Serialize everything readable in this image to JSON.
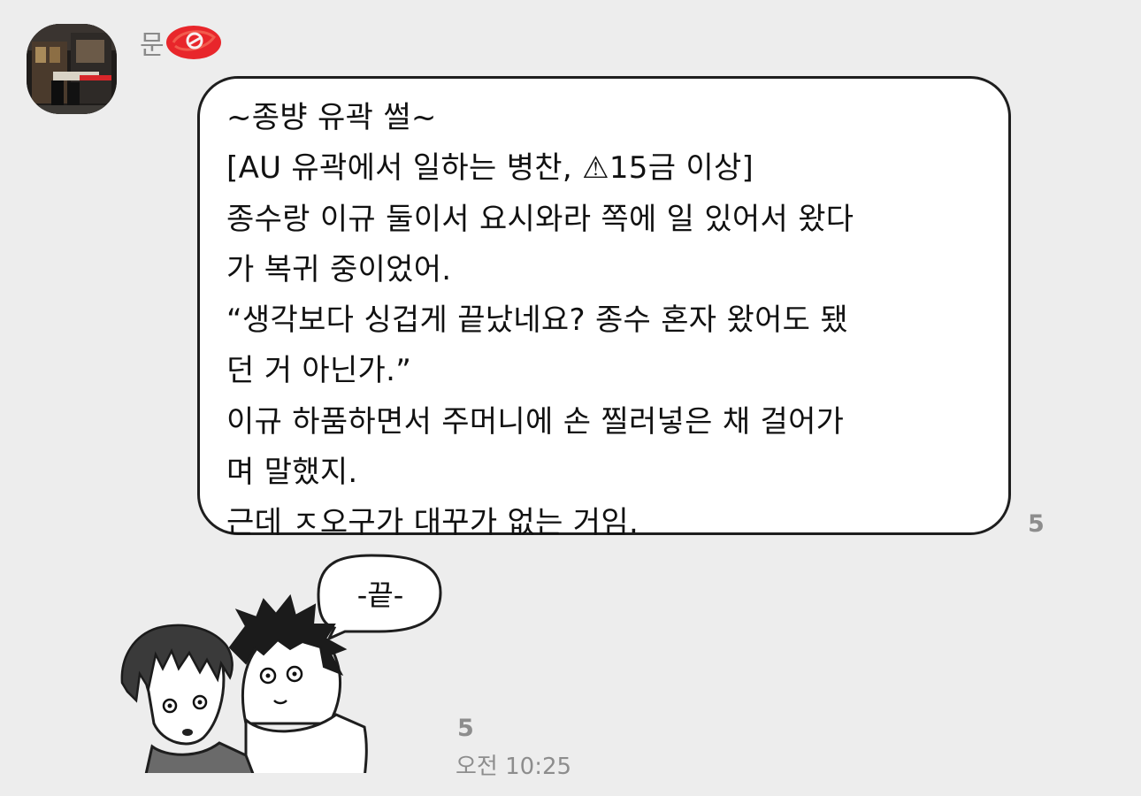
{
  "sender": {
    "name": "문"
  },
  "message": {
    "lines": [
      "~종뱡 유곽 썰~",
      "[AU 유곽에서 일하는 병찬, ⚠15금 이상]",
      "종수랑 이규 둘이서 요시와라 쪽에 일 있어서 왔다",
      "가 복귀 중이었어.",
      "“생각보다 싱겁게 끝났네요? 종수 혼자 왔어도 됐",
      "던 거 아닌가.”",
      "이규 하품하면서 주머니에 손 찔러넣은 채 걸어가",
      "며 말했지.",
      "근데 ㅈ오구가 대꾸가 없는 거임."
    ],
    "unread_count": "5"
  },
  "sticker": {
    "speech_text": "-끝-",
    "unread_count": "5",
    "timestamp": "오전 10:25"
  },
  "colors": {
    "background": "#ededed",
    "bubble": "#ffffff",
    "bubble_border": "#1e1e1e",
    "meta_text": "#8d8d8d",
    "redaction": "#e8262b"
  }
}
